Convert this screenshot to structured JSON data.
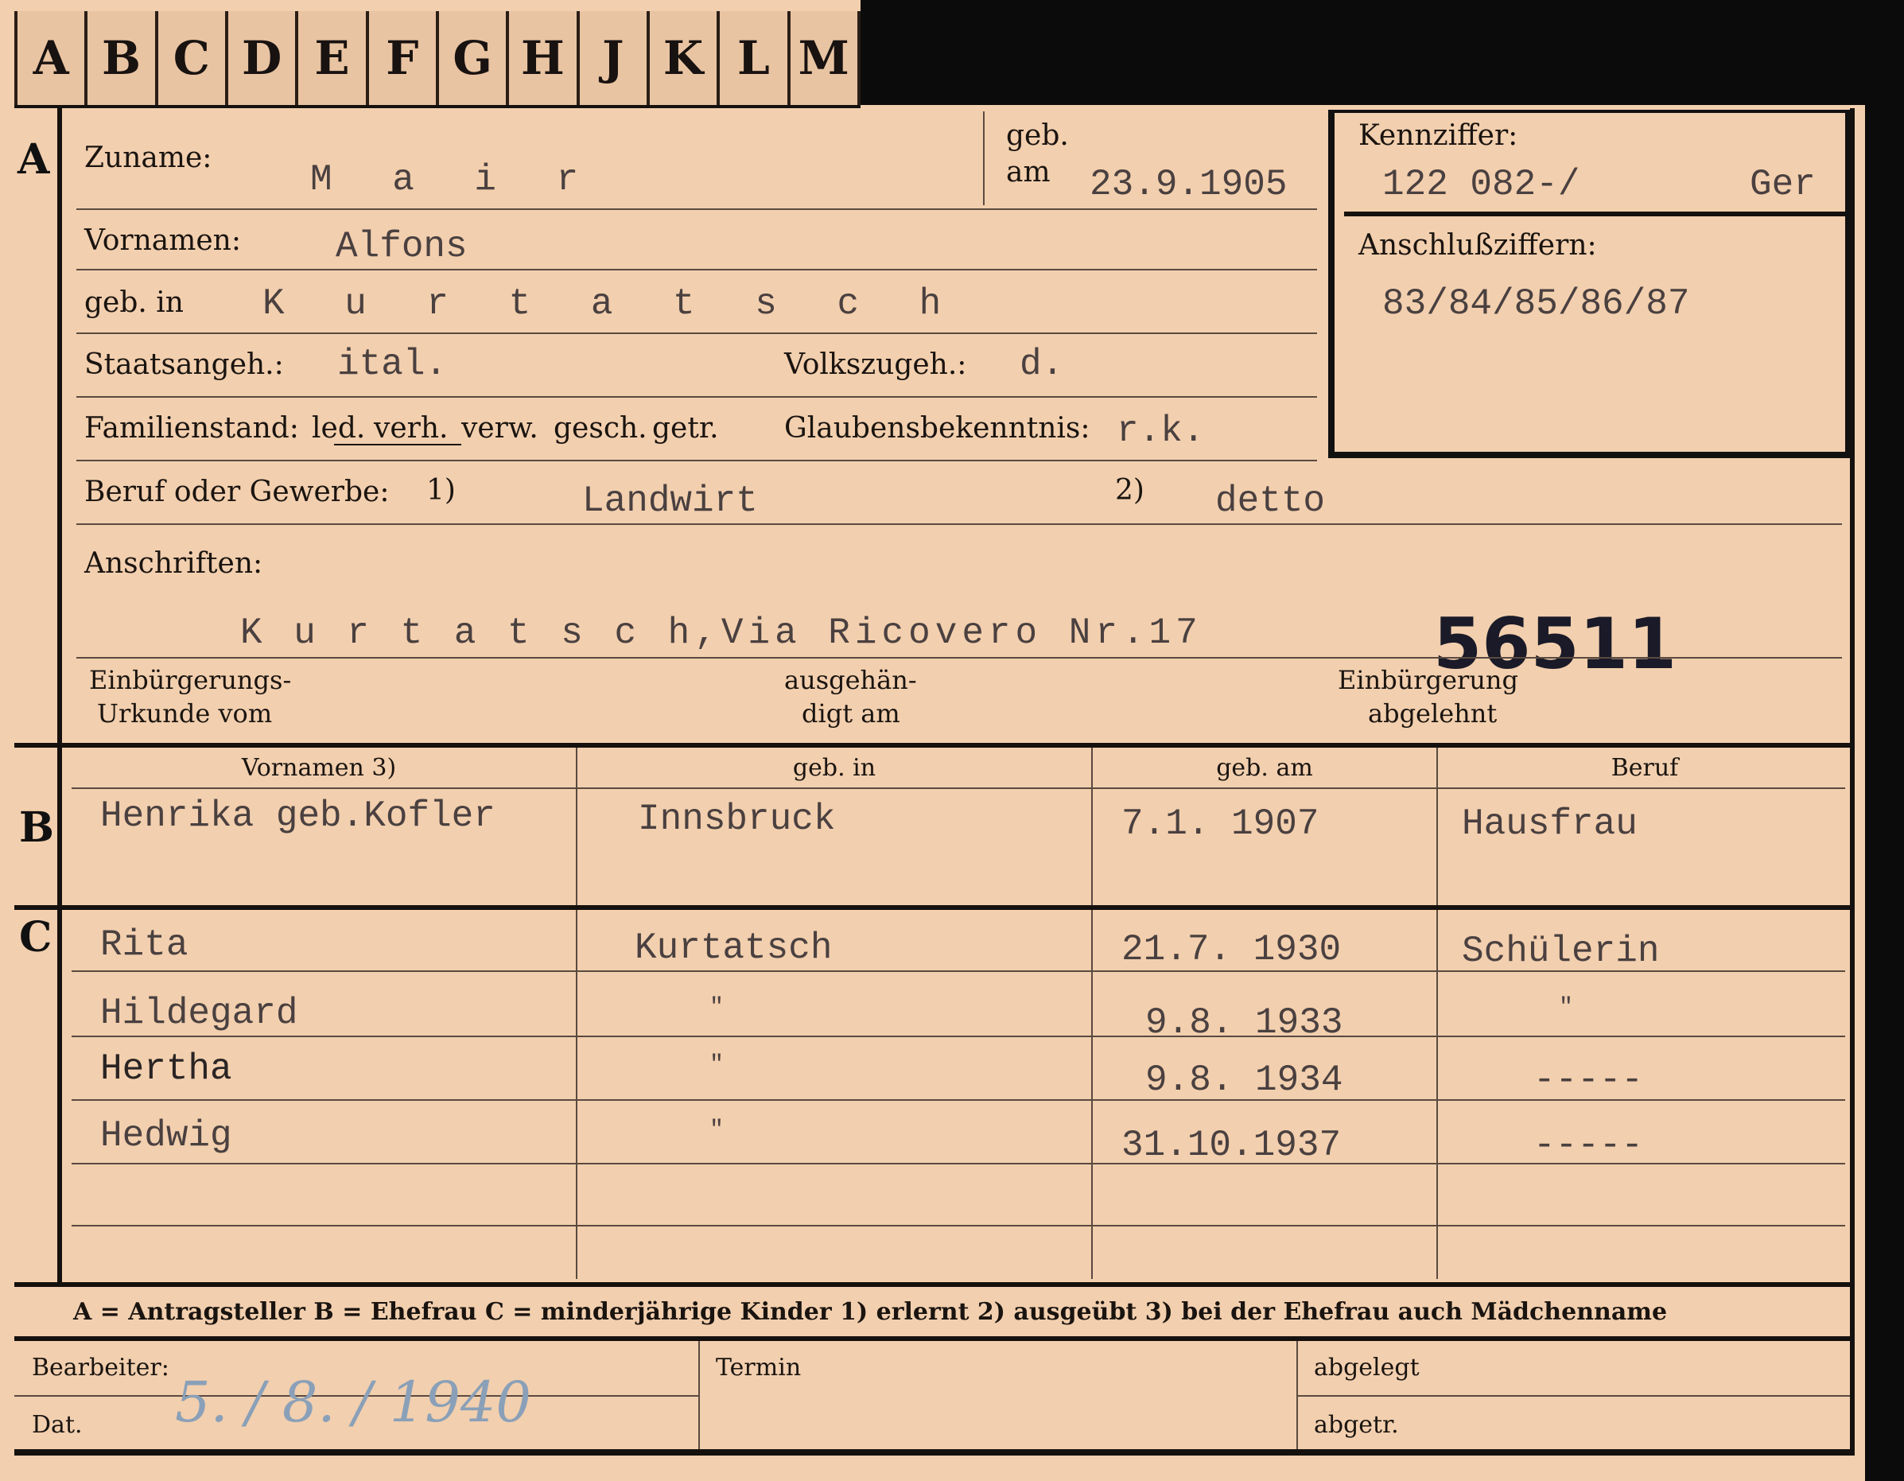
{
  "tabs": [
    "A",
    "B",
    "C",
    "D",
    "E",
    "F",
    "G",
    "H",
    "J",
    "K",
    "L",
    "M"
  ],
  "section_marks": {
    "a": "A",
    "b": "B",
    "c": "C"
  },
  "applicant": {
    "surname_label": "Zuname:",
    "surname": "M a i r",
    "born_on_label_1": "geb.",
    "born_on_label_2": "am",
    "born_on": "23.9.1905",
    "first_names_label": "Vornamen:",
    "first_names": "Alfons",
    "birthplace_label": "geb. in",
    "birthplace": "K u r t a t s c h",
    "citizenship_label": "Staatsangeh.:",
    "citizenship": "ital.",
    "ethnicity_label": "Volkszugeh.:",
    "ethnicity": "d.",
    "marital_label": "Familienstand:",
    "marital_options": [
      "led.",
      "verh.",
      "verw.",
      "gesch.",
      "getr."
    ],
    "religion_label": "Glaubensbekenntnis:",
    "religion": "r.k.",
    "occupation_label": "Beruf oder Gewerbe:",
    "occ_mark_1": "1)",
    "occupation_learned": "Landwirt",
    "occ_mark_2": "2)",
    "occupation_practiced": "detto",
    "address_label": "Anschriften:",
    "address": "K u r t a t s c h,Via Ricovero Nr.17",
    "number_stamp": "56511",
    "naturalization_label_1": "Einbürgerungs-",
    "naturalization_label_2": "Urkunde vom",
    "handed_label_1": "ausgehän-",
    "handed_label_2": "digt am",
    "rejected_label_1": "Einbürgerung",
    "rejected_label_2": "abgelehnt"
  },
  "reference": {
    "code_label": "Kennziffer:",
    "code": "122 082-/",
    "code_suffix": "Ger",
    "linked_label": "Anschlußziffern:",
    "linked": "83/84/85/86/87"
  },
  "table": {
    "headers": [
      "Vornamen 3)",
      "geb. in",
      "geb. am",
      "Beruf"
    ],
    "wife": {
      "name": "Henrika geb.Kofler",
      "birthplace": "Innsbruck",
      "born": "7.1. 1907",
      "occupation": "Hausfrau"
    },
    "children": [
      {
        "name": "Rita",
        "birthplace": "Kurtatsch",
        "born": "21.7. 1930",
        "occupation": "Schülerin"
      },
      {
        "name": "Hildegard",
        "birthplace": "\"",
        "born": "9.8. 1933",
        "occupation": "\""
      },
      {
        "name": "Hertha",
        "birthplace": "\"",
        "born": "9.8. 1934",
        "occupation": "-----"
      },
      {
        "name": "Hedwig",
        "birthplace": "\"",
        "born": "31.10.1937",
        "occupation": "-----"
      }
    ]
  },
  "legend": "A = Antragsteller   B = Ehefrau   C = minderjährige Kinder   1) erlernt   2) ausgeübt   3) bei der Ehefrau auch Mädchenname",
  "footer": {
    "clerk_label": "Bearbeiter:",
    "date_label": "Dat.",
    "date_handwritten": "5. / 8. / 1940",
    "deadline_label": "Termin",
    "filed_label": "abgelegt",
    "done_label": "abgetr."
  },
  "colors": {
    "card": "#f2cfae",
    "ink": "#1a1410",
    "typewriter": "#4a4040",
    "pencil": "#8aa0b8"
  }
}
